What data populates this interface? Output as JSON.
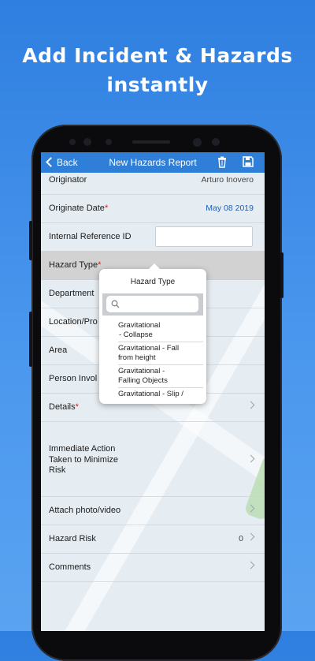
{
  "headline": {
    "line1": "Add Incident & Hazards",
    "line2": "instantly"
  },
  "navbar": {
    "back_label": "Back",
    "title": "New Hazards Report",
    "delete_icon": "trash-icon",
    "save_icon": "save-disk-icon",
    "color": "#2f7fd8"
  },
  "form": {
    "originator": {
      "label": "Originator",
      "value": "Arturo Inovero"
    },
    "originate_date": {
      "label": "Originate Date",
      "required": "*",
      "value": "May 08 2019"
    },
    "internal_ref": {
      "label": "Internal Reference ID",
      "value": ""
    },
    "hazard_type": {
      "label": "Hazard Type",
      "required": "*"
    },
    "department": {
      "label": "Department"
    },
    "location": {
      "label": "Location/Pro"
    },
    "area": {
      "label": "Area"
    },
    "person_involved": {
      "label": "Person Invol"
    },
    "details": {
      "label": "Details",
      "required": "*"
    },
    "immediate_action": {
      "line1": "Immediate Action",
      "line2": "Taken to Minimize",
      "line3": "Risk"
    },
    "attach": {
      "label": "Attach photo/video"
    },
    "hazard_risk": {
      "label": "Hazard Risk",
      "value": "0"
    },
    "comments": {
      "label": "Comments"
    }
  },
  "popover": {
    "title": "Hazard Type",
    "search_placeholder": "",
    "items": [
      {
        "line1": "Gravitational",
        "line2": "- Collapse"
      },
      {
        "line1": "Gravitational - Fall",
        "line2": "from height"
      },
      {
        "line1": "Gravitational -",
        "line2": "Falling Objects"
      },
      {
        "line1": "Gravitational - Slip /",
        "line2": ""
      }
    ]
  },
  "colors": {
    "background": "#3a8be6",
    "required": "#d31b1b"
  }
}
